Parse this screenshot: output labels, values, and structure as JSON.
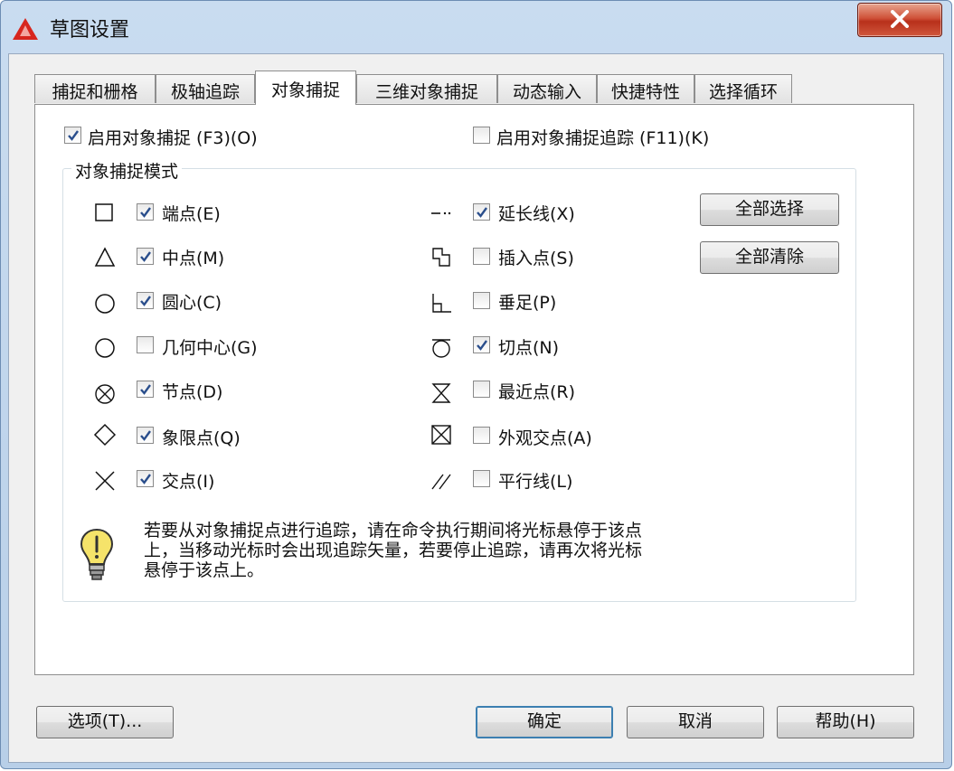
{
  "window": {
    "title": "草图设置",
    "accent": "#cf5138"
  },
  "tabs": [
    "捕捉和栅格",
    "极轴追踪",
    "对象捕捉",
    "三维对象捕捉",
    "动态输入",
    "快捷特性",
    "选择循环"
  ],
  "active_tab": "对象捕捉",
  "enable_osnap": {
    "label": "启用对象捕捉 (F3)(O)",
    "checked": true
  },
  "enable_tracking": {
    "label": "启用对象捕捉追踪 (F11)(K)",
    "checked": false
  },
  "group": {
    "title": "对象捕捉模式",
    "left_modes": [
      {
        "symbol": "square-icon",
        "label": "端点(E)",
        "checked": true
      },
      {
        "symbol": "triangle-icon",
        "label": "中点(M)",
        "checked": true
      },
      {
        "symbol": "circle-icon",
        "label": "圆心(C)",
        "checked": true
      },
      {
        "symbol": "geometric-center-icon",
        "label": "几何中心(G)",
        "checked": false
      },
      {
        "symbol": "node-icon",
        "label": "节点(D)",
        "checked": true
      },
      {
        "symbol": "diamond-icon",
        "label": "象限点(Q)",
        "checked": true
      },
      {
        "symbol": "x-cross-icon",
        "label": "交点(I)",
        "checked": true
      }
    ],
    "right_modes": [
      {
        "symbol": "extension-icon",
        "label": "延长线(X)",
        "checked": true
      },
      {
        "symbol": "insertion-icon",
        "label": "插入点(S)",
        "checked": false
      },
      {
        "symbol": "perpendicular-icon",
        "label": "垂足(P)",
        "checked": false
      },
      {
        "symbol": "tangent-icon",
        "label": "切点(N)",
        "checked": true
      },
      {
        "symbol": "nearest-icon",
        "label": "最近点(R)",
        "checked": false
      },
      {
        "symbol": "apparent-intersection-icon",
        "label": "外观交点(A)",
        "checked": false
      },
      {
        "symbol": "parallel-icon",
        "label": "平行线(L)",
        "checked": false
      }
    ],
    "select_all": "全部选择",
    "clear_all": "全部清除"
  },
  "hint": {
    "lines": [
      "若要从对象捕捉点进行追踪，请在命令执行期间将光标悬停于该点",
      "上，当移动光标时会出现追踪矢量，若要停止追踪，请再次将光标",
      "悬停于该点上。"
    ]
  },
  "footer": {
    "options": "选项(T)...",
    "ok": "确定",
    "cancel": "取消",
    "help": "帮助(H)"
  }
}
